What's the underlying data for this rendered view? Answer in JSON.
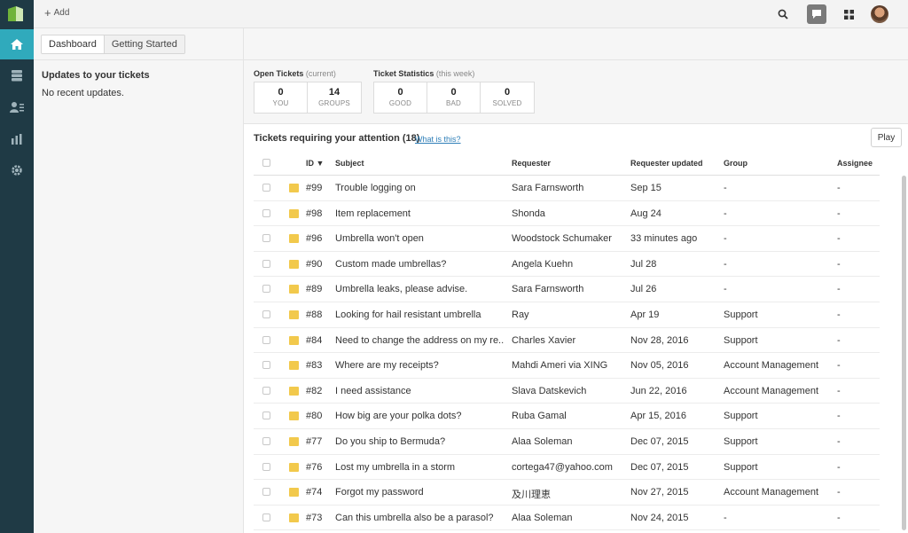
{
  "topbar": {
    "add_label": "Add"
  },
  "tabs": [
    {
      "label": "Dashboard",
      "active": true
    },
    {
      "label": "Getting Started",
      "active": false
    }
  ],
  "updates": {
    "title": "Updates to your tickets",
    "empty": "No recent updates."
  },
  "open_tickets": {
    "label": "Open Tickets",
    "qualifier": "(current)",
    "boxes": [
      {
        "value": "0",
        "caption": "YOU"
      },
      {
        "value": "14",
        "caption": "GROUPS"
      }
    ]
  },
  "ticket_stats": {
    "label": "Ticket Statistics",
    "qualifier": "(this week)",
    "boxes": [
      {
        "value": "0",
        "caption": "GOOD"
      },
      {
        "value": "0",
        "caption": "BAD"
      },
      {
        "value": "0",
        "caption": "SOLVED"
      }
    ]
  },
  "attention": {
    "title": "Tickets requiring your attention",
    "count": "(18)",
    "link": "What is this?",
    "play": "Play"
  },
  "table": {
    "headers": {
      "id": "ID ▼",
      "subject": "Subject",
      "requester": "Requester",
      "updated": "Requester updated",
      "group": "Group",
      "assignee": "Assignee"
    },
    "rows": [
      {
        "id": "#99",
        "subject": "Trouble logging on",
        "requester": "Sara Farnsworth",
        "updated": "Sep 15",
        "group": "-",
        "assignee": "-"
      },
      {
        "id": "#98",
        "subject": "Item replacement",
        "requester": "Shonda",
        "updated": "Aug 24",
        "group": "-",
        "assignee": "-"
      },
      {
        "id": "#96",
        "subject": "Umbrella won't open",
        "requester": "Woodstock Schumaker",
        "updated": "33 minutes ago",
        "group": "-",
        "assignee": "-"
      },
      {
        "id": "#90",
        "subject": "Custom made umbrellas?",
        "requester": "Angela Kuehn",
        "updated": "Jul 28",
        "group": "-",
        "assignee": "-"
      },
      {
        "id": "#89",
        "subject": "Umbrella leaks, please advise.",
        "requester": "Sara Farnsworth",
        "updated": "Jul 26",
        "group": "-",
        "assignee": "-"
      },
      {
        "id": "#88",
        "subject": "Looking for hail resistant umbrella",
        "requester": "Ray",
        "updated": "Apr 19",
        "group": "Support",
        "assignee": "-"
      },
      {
        "id": "#84",
        "subject": "Need to change the address on my re...",
        "requester": "Charles Xavier",
        "updated": "Nov 28, 2016",
        "group": "Support",
        "assignee": "-"
      },
      {
        "id": "#83",
        "subject": "Where are my receipts?",
        "requester": "Mahdi Ameri via XING",
        "updated": "Nov 05, 2016",
        "group": "Account Management",
        "assignee": "-"
      },
      {
        "id": "#82",
        "subject": "I need assistance",
        "requester": "Slava Datskevich",
        "updated": "Jun 22, 2016",
        "group": "Account Management",
        "assignee": "-"
      },
      {
        "id": "#80",
        "subject": "How big are your polka dots?",
        "requester": "Ruba Gamal",
        "updated": "Apr 15, 2016",
        "group": "Support",
        "assignee": "-"
      },
      {
        "id": "#77",
        "subject": "Do you ship to Bermuda?",
        "requester": "Alaa Soleman",
        "updated": "Dec 07, 2015",
        "group": "Support",
        "assignee": "-"
      },
      {
        "id": "#76",
        "subject": "Lost my umbrella in a storm",
        "requester": "cortega47@yahoo.com",
        "updated": "Dec 07, 2015",
        "group": "Support",
        "assignee": "-"
      },
      {
        "id": "#74",
        "subject": "Forgot my password",
        "requester": "及川理恵",
        "updated": "Nov 27, 2015",
        "group": "Account Management",
        "assignee": "-"
      },
      {
        "id": "#73",
        "subject": "Can this umbrella also be a parasol?",
        "requester": "Alaa Soleman",
        "updated": "Nov 24, 2015",
        "group": "-",
        "assignee": "-"
      }
    ]
  },
  "icons": {
    "nav": [
      "home-icon",
      "views-icon",
      "customers-icon",
      "reporting-icon",
      "admin-gear-icon"
    ],
    "topbar": [
      "search-icon",
      "chat-icon",
      "apps-grid-icon",
      "user-avatar"
    ]
  },
  "colors": {
    "nav_bg": "#1f3a45",
    "nav_active": "#30aabc",
    "priority": "#f2c94c",
    "link": "#2f7fb8"
  }
}
